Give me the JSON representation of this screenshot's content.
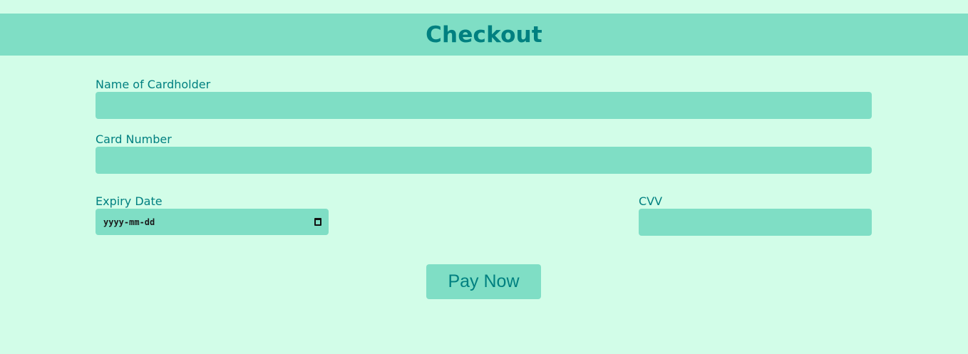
{
  "header": {
    "title": "Checkout"
  },
  "form": {
    "cardholder_label": "Name of Cardholder",
    "card_number_label": "Card Number",
    "expiry_label": "Expiry Date",
    "expiry_placeholder": "yyyy-mm-dd",
    "cvv_label": "CVV",
    "pay_button_label": "Pay Now"
  },
  "colors": {
    "background": "#d2fde8",
    "accent": "#7fdec5",
    "text": "#008080"
  },
  "icons": {
    "date_picker": "calendar-icon"
  }
}
